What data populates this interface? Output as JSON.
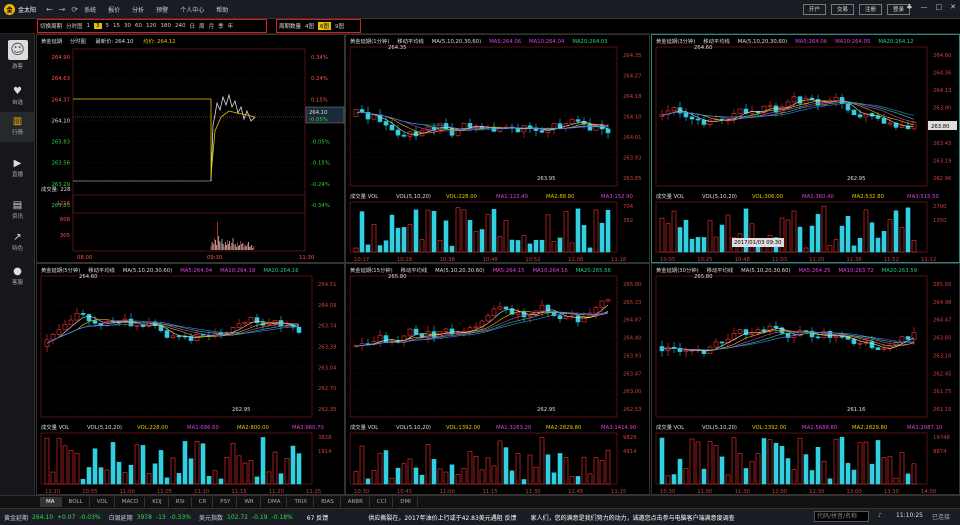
{
  "app": {
    "name": "金太阳",
    "menu": [
      "系统",
      "报价",
      "分析",
      "预警",
      "个人中心",
      "帮助"
    ],
    "buttons": [
      "开户",
      "交易",
      "注册",
      "登录"
    ]
  },
  "toolbar": {
    "group1": {
      "label": "切换周期",
      "items": [
        "分时图",
        "1",
        "3",
        "5",
        "15",
        "30",
        "60",
        "120",
        "180",
        "240",
        "日",
        "周",
        "月",
        "季",
        "年"
      ],
      "selected": "3"
    },
    "group2": {
      "label": "周期数量",
      "items": [
        "4图",
        "6图",
        "9图"
      ],
      "selected": "6图"
    }
  },
  "sidebar": [
    {
      "label": "游客",
      "icon": "avatar-icon"
    },
    {
      "label": "自选",
      "icon": "heart-icon"
    },
    {
      "label": "行情",
      "icon": "chart-icon"
    },
    {
      "label": "直播",
      "icon": "play-icon"
    },
    {
      "label": "资讯",
      "icon": "news-icon"
    },
    {
      "label": "特色",
      "icon": "trend-icon"
    },
    {
      "label": "客服",
      "icon": "chat-icon"
    }
  ],
  "intraday": {
    "name": "黄金延期",
    "period": "分时图",
    "last_label": "最新价: 264.10",
    "avg_label": "均价: 264.12",
    "prices": [
      "264.90",
      "264.63",
      "264.37",
      "264.10",
      "263.83",
      "263.56",
      "263.29",
      "263.03"
    ],
    "pcts": [
      "0.34%",
      "0.24%",
      "0.15%",
      "0.05%",
      "-0.05%",
      "-0.15%",
      "-0.24%",
      "-0.34%"
    ],
    "price_box": "264.10",
    "pct_box": "-0.05%",
    "vol_label": "成交量: 228",
    "vol_ticks": [
      "1216",
      "608",
      "305"
    ],
    "times": [
      "08:00",
      "09:30",
      "11:30"
    ]
  },
  "panels": [
    {
      "name": "黄金延期(1分钟)",
      "ind": "移动平均线",
      "ma": "MA(5,10,20,30,60)",
      "ma5": "MA5:264.06",
      "ma10": "MA10:264.04",
      "ma20": "MA20:264.03",
      "high": "264.35",
      "low": "263.95",
      "prices": [
        "264.35",
        "264.27",
        "264.18",
        "264.10",
        "264.01",
        "263.93",
        "263.85"
      ],
      "vol": "成交量 VOL",
      "vol_ma": "VOL(5,10,20)",
      "vol_val": "VOL:228.00",
      "vma1": "MA1:122.40",
      "vma2": "MA2:88.80",
      "vma3": "MA3:152.90",
      "vol_ticks": [
        "704",
        "352"
      ],
      "times": [
        "10:17",
        "10:28",
        "10:38",
        "10:48",
        "10:52",
        "11:08",
        "11:18"
      ]
    },
    {
      "name": "黄金延期(3分钟)",
      "ind": "移动平均线",
      "ma": "MA(5,10,20,30,60)",
      "ma5": "MA5:264.06",
      "ma10": "MA10:264.05",
      "ma20": "MA20:264.12",
      "high": "264.60",
      "low": "262.95",
      "prices": [
        "264.60",
        "264.36",
        "264.13",
        "263.90",
        "263.66",
        "263.43",
        "263.19",
        "262.96"
      ],
      "price_box": "263.80",
      "vol": "成交量 VOL",
      "vol_ma": "VOL(5,10,20)",
      "vol_val": "VOL:306.00",
      "vma1": "MA1:360.40",
      "vma2": "MA2:532.80",
      "vma3": "MA3:515.50",
      "vol_ticks": [
        "2700",
        "1350"
      ],
      "tooltip": "2017/01/03 09:30",
      "times": [
        "10:05",
        "10:25",
        "10:48",
        "11:03",
        "11:20",
        "11:38",
        "11:52",
        "11:12"
      ]
    },
    {
      "name": "黄金延期(5分钟)",
      "ind": "移动平均线",
      "ma": "MA(5,10,20,30,60)",
      "ma5": "MA5:264.04",
      "ma10": "MA10:264.18",
      "ma20": "MA20:264.16",
      "high": "264.60",
      "low": "262.95",
      "prices": [
        "264.51",
        "264.09",
        "263.74",
        "263.39",
        "263.04",
        "262.70",
        "262.35"
      ],
      "vol": "成交量 VOL",
      "vol_ma": "VOL(5,10,20)",
      "vol_val": "VOL:228.00",
      "vma1": "MA1:686.60",
      "vma2": "MA2:800.00",
      "vma3": "MA3:960.70",
      "vol_ticks": [
        "3828",
        "1914"
      ],
      "times": [
        "11:10",
        "10:55",
        "11:00",
        "11:05",
        "11:10",
        "11:15",
        "11:20",
        "11:25"
      ]
    },
    {
      "name": "黄金延期(15分钟)",
      "ind": "移动平均线",
      "ma": "MA(5,10,20,30,60)",
      "ma5": "MA5:264.15",
      "ma10": "MA10:264.16",
      "ma20": "MA20:265.66",
      "high": "265.80",
      "low": "262.95",
      "prices": [
        "265.80",
        "265.33",
        "264.87",
        "264.40",
        "263.93",
        "263.47",
        "263.00",
        "262.53"
      ],
      "vol": "成交量 VOL",
      "vol_ma": "VOL(5,10,20)",
      "vol_val": "VOL:1392.00",
      "vma1": "MA1:3283.20",
      "vma2": "MA2:2829.80",
      "vma3": "MA3:1414.90",
      "vol_ticks": [
        "9829",
        "4914"
      ],
      "times": [
        "10:30",
        "10:45",
        "11:00",
        "11:15",
        "11:30",
        "11:45",
        "11:15"
      ]
    },
    {
      "name": "黄金延期(30分钟)",
      "ind": "移动平均线",
      "ma": "MA(5,10,20,30,60)",
      "ma5": "MA5:264.25",
      "ma10": "MA10:263.72",
      "ma20": "MA20:263.59",
      "high": "265.80",
      "low": "261.16",
      "prices": [
        "265.50",
        "264.98",
        "264.47",
        "263.85",
        "263.16",
        "262.45",
        "261.75",
        "261.15"
      ],
      "vol": "成交量 VOL",
      "vol_ma": "VOL(5,10,20)",
      "vol_val": "VOL:1392.00",
      "vma1": "MA1:5688.80",
      "vma2": "MA2:2829.80",
      "vma3": "MA3:2087.10",
      "vol_ticks": [
        "19748",
        "9874"
      ],
      "times": [
        "10:30",
        "11:00",
        "11:30",
        "12:00",
        "12:30",
        "13:00",
        "13:30",
        "14:00"
      ]
    }
  ],
  "indicators": [
    "MA",
    "BOLL",
    "VOL",
    "MACD",
    "KDJ",
    "RSI",
    "CR",
    "PSY",
    "WR",
    "DMA",
    "TRIX",
    "BIAS",
    "ARBR",
    "CCI",
    "DMI"
  ],
  "indicator_selected": "MA",
  "status": {
    "q1_name": "黄金延期",
    "q1_val": "264.10",
    "q1_chg": "+0.07",
    "q1_pct": "-0.03%",
    "q2_name": "白银延期",
    "q2_val": "3978",
    "q2_chg": "-13",
    "q2_pct": "-0.33%",
    "q3_name": "美元指数",
    "q3_val": "102.72",
    "q3_chg": "-0.19",
    "q3_pct": "-0.18%",
    "news": "67 反馈",
    "ticker": "供应撕裂在，2017年油价上行或于42.83美元遇阻 反馈",
    "ticker2": "家人们，您的满意是我们努力的动力，诚邀您点击参与电脑客户端满意度调查",
    "search": "代码/拼音/名称",
    "time": "11:10:25",
    "conn": "已连接"
  }
}
